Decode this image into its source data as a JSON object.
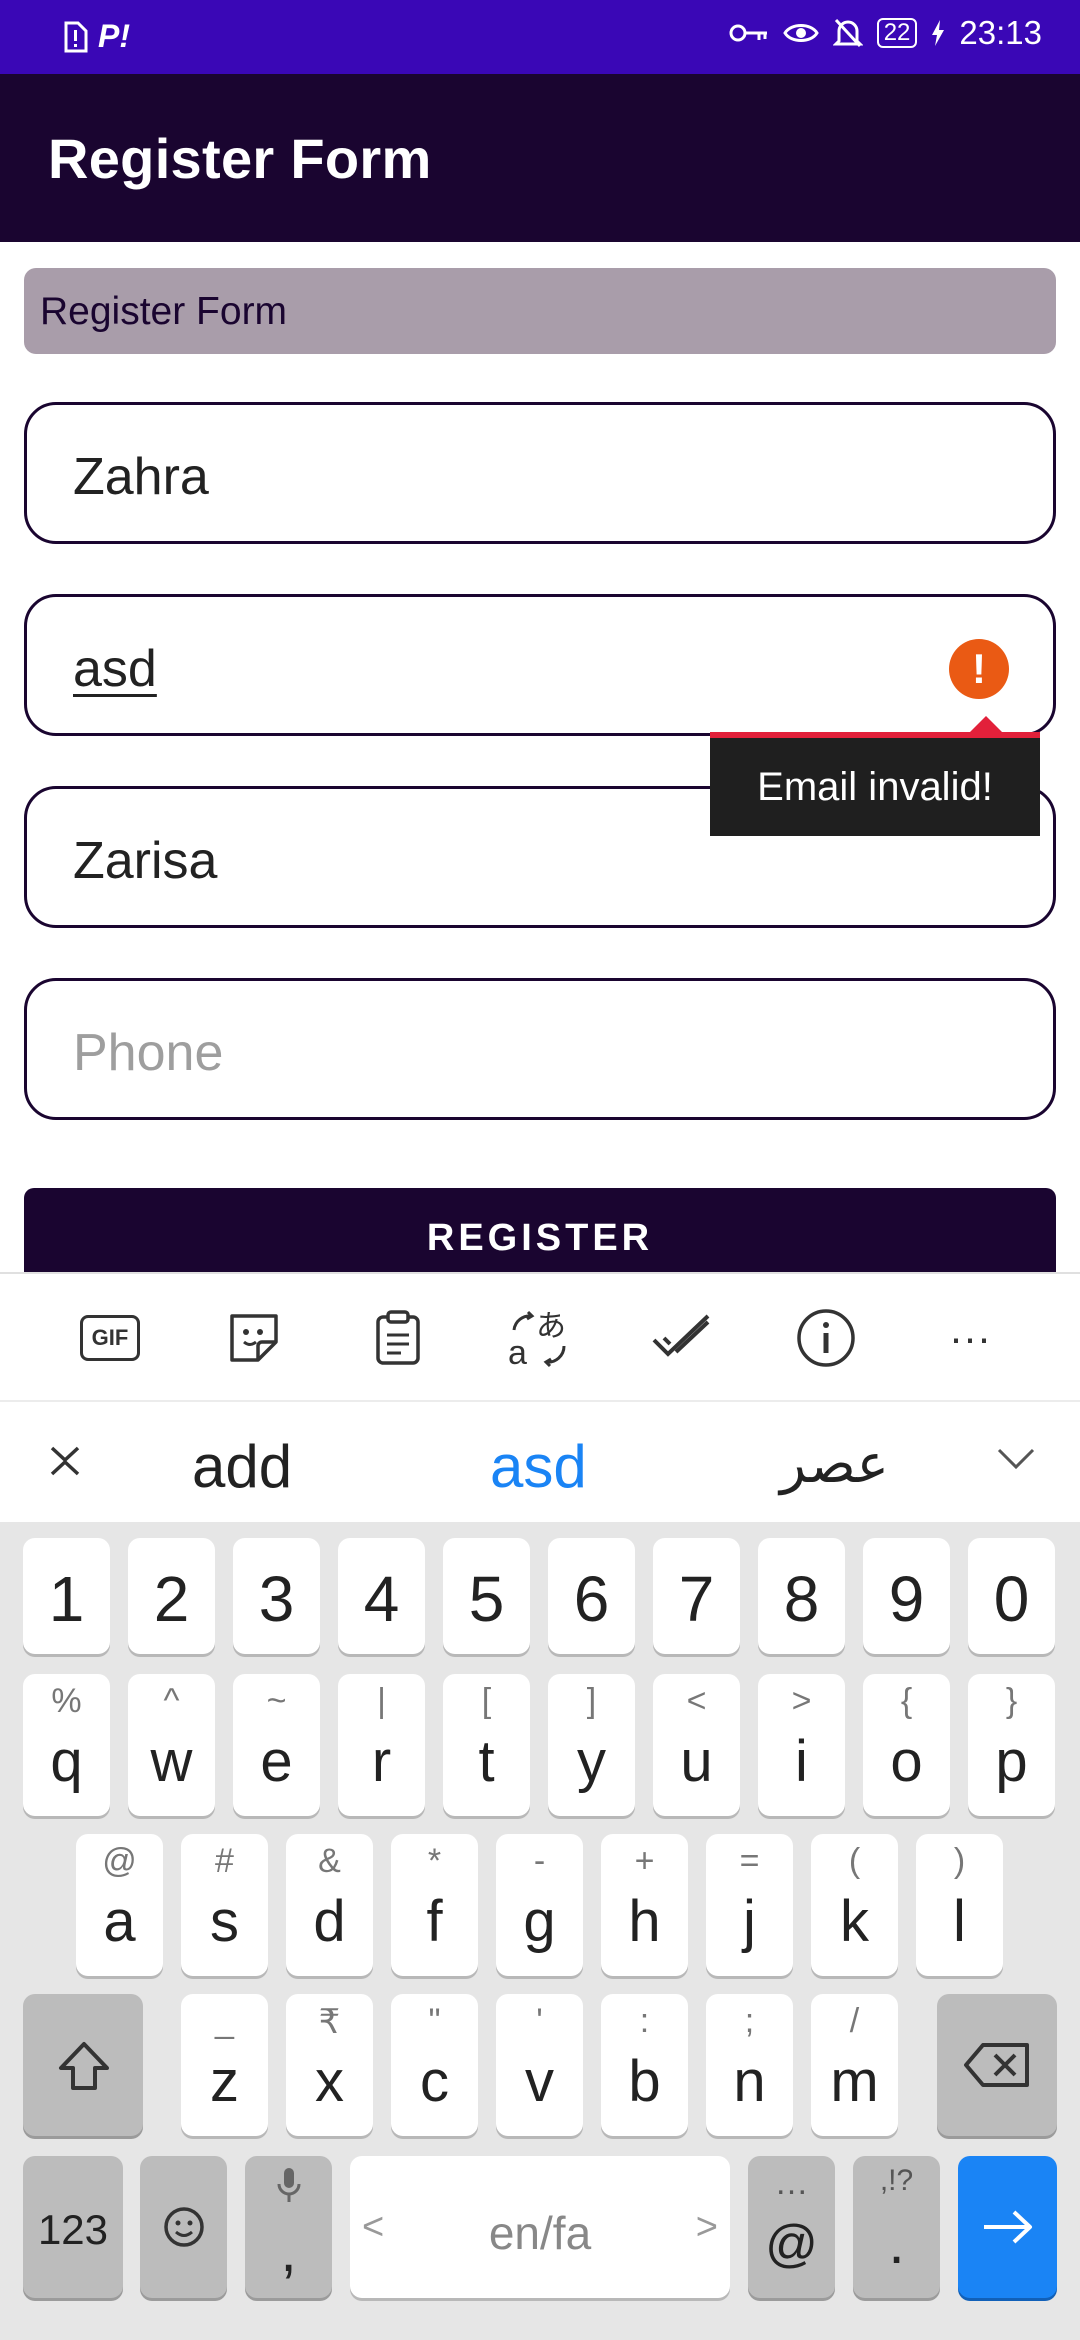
{
  "status_bar": {
    "time": "23:13",
    "battery": "22",
    "left_glyph": "P!"
  },
  "app_bar": {
    "title": "Register Form"
  },
  "form": {
    "header_label": "Register Form",
    "name_value": "Zahra",
    "email_value": "asd",
    "email_error_icon": "!",
    "email_error": "Email invalid!",
    "third_value": "Zarisa",
    "phone_placeholder": "Phone",
    "register_label": "REGISTER"
  },
  "keyboard": {
    "toolbar_icons": [
      "gif-icon",
      "sticker-icon",
      "clipboard-icon",
      "translate-icon",
      "checkmark-icon",
      "info-icon",
      "more-icon"
    ],
    "gif_label": "GIF",
    "more_label": "···",
    "suggestions": [
      "add",
      "asd",
      "عصر"
    ],
    "highlighted_suggestion": "asd",
    "number_row": [
      "1",
      "2",
      "3",
      "4",
      "5",
      "6",
      "7",
      "8",
      "9",
      "0"
    ],
    "row1": [
      {
        "k": "q",
        "s": "%"
      },
      {
        "k": "w",
        "s": "^"
      },
      {
        "k": "e",
        "s": "~"
      },
      {
        "k": "r",
        "s": "|"
      },
      {
        "k": "t",
        "s": "["
      },
      {
        "k": "y",
        "s": "]"
      },
      {
        "k": "u",
        "s": "<"
      },
      {
        "k": "i",
        "s": ">"
      },
      {
        "k": "o",
        "s": "{"
      },
      {
        "k": "p",
        "s": "}"
      }
    ],
    "row2": [
      {
        "k": "a",
        "s": "@"
      },
      {
        "k": "s",
        "s": "#"
      },
      {
        "k": "d",
        "s": "&"
      },
      {
        "k": "f",
        "s": "*"
      },
      {
        "k": "g",
        "s": "-"
      },
      {
        "k": "h",
        "s": "+"
      },
      {
        "k": "j",
        "s": "="
      },
      {
        "k": "k",
        "s": "("
      },
      {
        "k": "l",
        "s": ")"
      }
    ],
    "row3": [
      {
        "k": "z",
        "s": "_"
      },
      {
        "k": "x",
        "s": "₹"
      },
      {
        "k": "c",
        "s": "\""
      },
      {
        "k": "v",
        "s": "'"
      },
      {
        "k": "b",
        "s": ":"
      },
      {
        "k": "n",
        "s": ";"
      },
      {
        "k": "m",
        "s": "/"
      }
    ],
    "bottom": {
      "numbers_label": "123",
      "comma_label": ",",
      "space_label": "en/fa",
      "space_left": "<",
      "space_right": ">",
      "at_label": "@",
      "at_secondary": "…",
      "period_label": ".",
      "period_secondary": ",!?"
    },
    "accent_color": "#1a84f5"
  }
}
